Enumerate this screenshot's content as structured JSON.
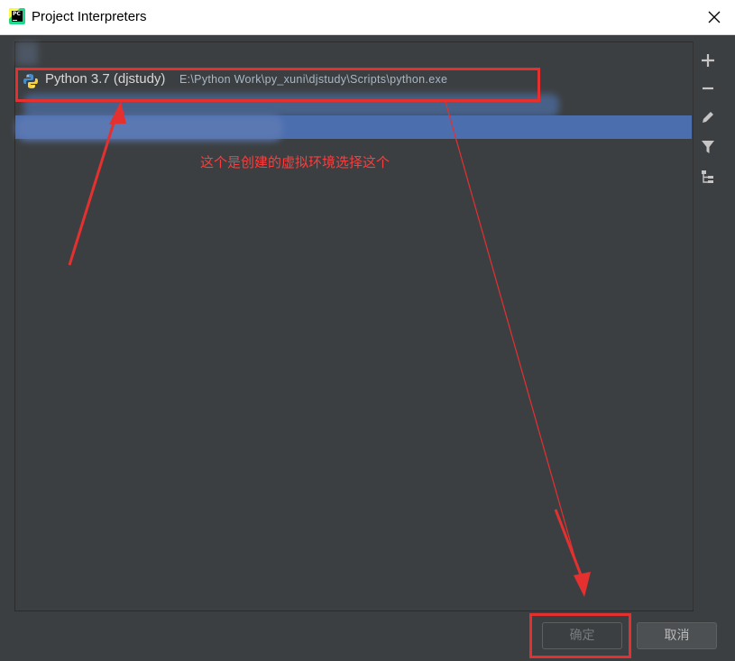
{
  "window": {
    "title": "Project Interpreters",
    "app_icon": "pycharm-icon",
    "close_icon": "close-icon"
  },
  "interpreters": [
    {
      "name": "Python 3.7 (djstudy)",
      "path": "E:\\Python Work\\py_xuni\\djstudy\\Scripts\\python.exe",
      "icon": "python-icon"
    }
  ],
  "toolbar": {
    "items": [
      "add-icon",
      "remove-icon",
      "edit-icon",
      "filter-icon",
      "tree-icon"
    ]
  },
  "annotation": {
    "text": "这个是创建的虚拟环境选择这个",
    "color": "#ff3b3b"
  },
  "buttons": {
    "ok_label": "确定",
    "cancel_label": "取消"
  },
  "colors": {
    "background": "#3c3f41",
    "selection": "#4b6eaf",
    "annotation_red": "#e53030"
  }
}
